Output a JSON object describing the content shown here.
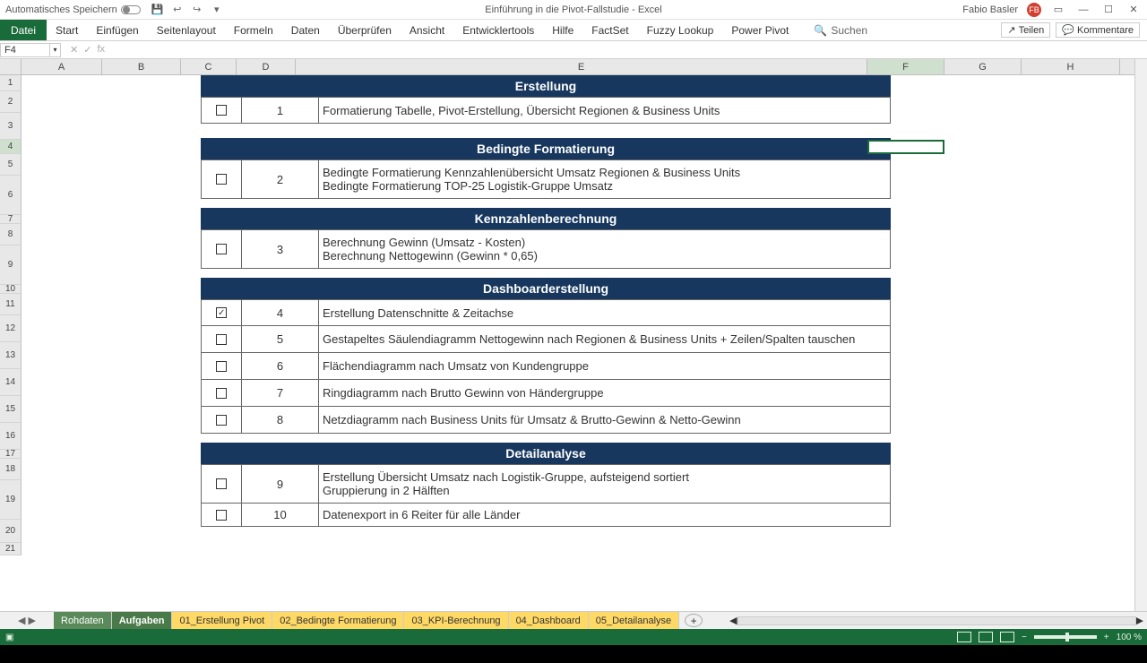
{
  "titlebar": {
    "autosave": "Automatisches Speichern",
    "doc_title": "Einführung in die Pivot-Fallstudie  -  Excel",
    "user": "Fabio Basler",
    "user_initials": "FB"
  },
  "ribbon": {
    "tabs": [
      "Datei",
      "Start",
      "Einfügen",
      "Seitenlayout",
      "Formeln",
      "Daten",
      "Überprüfen",
      "Ansicht",
      "Entwicklertools",
      "Hilfe",
      "FactSet",
      "Fuzzy Lookup",
      "Power Pivot"
    ],
    "search_placeholder": "Suchen",
    "share": "Teilen",
    "comments": "Kommentare"
  },
  "formula_bar": {
    "namebox": "F4",
    "fx_label": "fx"
  },
  "columns": [
    "A",
    "B",
    "C",
    "D",
    "E",
    "F",
    "G",
    "H"
  ],
  "row_numbers": [
    "1",
    "2",
    "3",
    "4",
    "5",
    "6",
    "7",
    "8",
    "9",
    "10",
    "11",
    "12",
    "13",
    "14",
    "15",
    "16",
    "17",
    "18",
    "19",
    "20",
    "21"
  ],
  "sections": {
    "s1": {
      "header": "Erstellung",
      "rows": [
        {
          "num": "1",
          "desc": "Formatierung Tabelle, Pivot-Erstellung, Übersicht Regionen & Business Units"
        }
      ]
    },
    "s2": {
      "header": "Bedingte Formatierung",
      "rows": [
        {
          "num": "2",
          "desc1": "Bedingte Formatierung Kennzahlenübersicht Umsatz Regionen & Business Units",
          "desc2": "Bedingte Formatierung TOP-25 Logistik-Gruppe Umsatz"
        }
      ]
    },
    "s3": {
      "header": "Kennzahlenberechnung",
      "rows": [
        {
          "num": "3",
          "desc1": "Berechnung Gewinn (Umsatz - Kosten)",
          "desc2": "Berechnung Nettogewinn (Gewinn * 0,65)"
        }
      ]
    },
    "s4": {
      "header": "Dashboarderstellung",
      "rows": [
        {
          "num": "4",
          "desc": "Erstellung Datenschnitte & Zeitachse"
        },
        {
          "num": "5",
          "desc": "Gestapeltes Säulendiagramm Nettogewinn nach Regionen & Business Units + Zeilen/Spalten tauschen"
        },
        {
          "num": "6",
          "desc": "Flächendiagramm nach Umsatz von Kundengruppe"
        },
        {
          "num": "7",
          "desc": "Ringdiagramm nach Brutto Gewinn von Händergruppe"
        },
        {
          "num": "8",
          "desc": "Netzdiagramm nach Business Units für Umsatz & Brutto-Gewinn & Netto-Gewinn"
        }
      ]
    },
    "s5": {
      "header": "Detailanalyse",
      "rows": [
        {
          "num": "9",
          "desc1": "Erstellung Übersicht Umsatz nach Logistik-Gruppe, aufsteigend sortiert",
          "desc2": "Gruppierung in 2 Hälften"
        },
        {
          "num": "10",
          "desc": "Datenexport in 6 Reiter für alle Länder"
        }
      ]
    }
  },
  "sheet_tabs": [
    "Rohdaten",
    "Aufgaben",
    "01_Erstellung Pivot",
    "02_Bedingte Formatierung",
    "03_KPI-Berechnung",
    "04_Dashboard",
    "05_Detailanalyse"
  ],
  "statusbar": {
    "zoom": "100 %"
  }
}
